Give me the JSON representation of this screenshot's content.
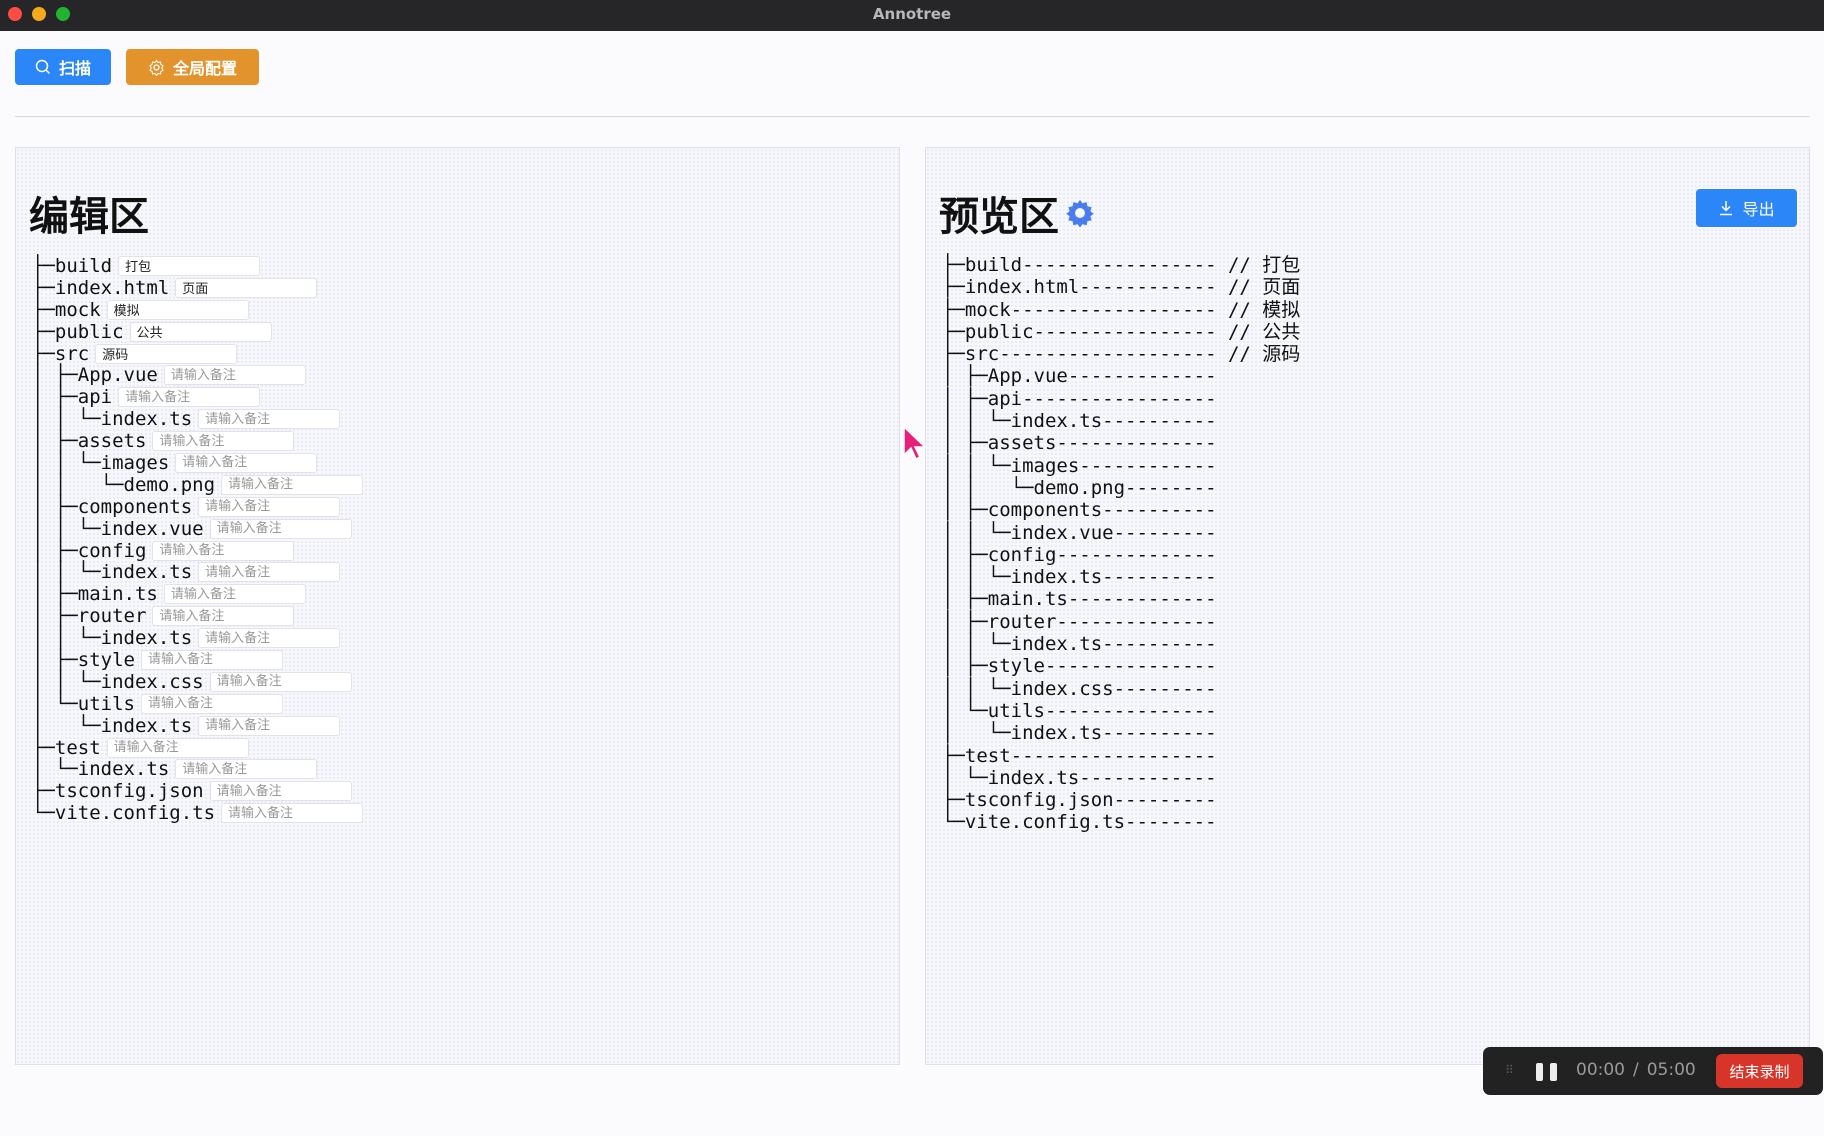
{
  "window": {
    "title": "Annotree"
  },
  "toolbar": {
    "scan_label": "扫描",
    "config_label": "全局配置"
  },
  "editor": {
    "title": "编辑区",
    "placeholder": "请输入备注",
    "rows": [
      {
        "prefix": "├─",
        "name": "build",
        "note": "打包"
      },
      {
        "prefix": "├─",
        "name": "index.html",
        "note": "页面"
      },
      {
        "prefix": "├─",
        "name": "mock",
        "note": "模拟"
      },
      {
        "prefix": "├─",
        "name": "public",
        "note": "公共"
      },
      {
        "prefix": "├─",
        "name": "src",
        "note": "源码"
      },
      {
        "prefix": "│ ├─",
        "name": "App.vue",
        "note": ""
      },
      {
        "prefix": "│ ├─",
        "name": "api",
        "note": ""
      },
      {
        "prefix": "│ │ └─",
        "name": "index.ts",
        "note": ""
      },
      {
        "prefix": "│ ├─",
        "name": "assets",
        "note": ""
      },
      {
        "prefix": "│ │ └─",
        "name": "images",
        "note": ""
      },
      {
        "prefix": "│ │   └─",
        "name": "demo.png",
        "note": ""
      },
      {
        "prefix": "│ ├─",
        "name": "components",
        "note": ""
      },
      {
        "prefix": "│ │ └─",
        "name": "index.vue",
        "note": ""
      },
      {
        "prefix": "│ ├─",
        "name": "config",
        "note": ""
      },
      {
        "prefix": "│ │ └─",
        "name": "index.ts",
        "note": ""
      },
      {
        "prefix": "│ ├─",
        "name": "main.ts",
        "note": ""
      },
      {
        "prefix": "│ ├─",
        "name": "router",
        "note": ""
      },
      {
        "prefix": "│ │ └─",
        "name": "index.ts",
        "note": ""
      },
      {
        "prefix": "│ ├─",
        "name": "style",
        "note": ""
      },
      {
        "prefix": "│ │ └─",
        "name": "index.css",
        "note": ""
      },
      {
        "prefix": "│ └─",
        "name": "utils",
        "note": ""
      },
      {
        "prefix": "│   └─",
        "name": "index.ts",
        "note": ""
      },
      {
        "prefix": "├─",
        "name": "test",
        "note": ""
      },
      {
        "prefix": "│ └─",
        "name": "index.ts",
        "note": ""
      },
      {
        "prefix": "├─",
        "name": "tsconfig.json",
        "note": ""
      },
      {
        "prefix": "└─",
        "name": "vite.config.ts",
        "note": ""
      }
    ]
  },
  "preview": {
    "title": "预览区",
    "export_label": "导出",
    "lines": [
      "├─build----------------- // 打包",
      "├─index.html------------ // 页面",
      "├─mock------------------ // 模拟",
      "├─public---------------- // 公共",
      "├─src------------------- // 源码",
      "│ ├─App.vue-------------",
      "│ ├─api-----------------",
      "│ │ └─index.ts----------",
      "│ ├─assets--------------",
      "│ │ └─images------------",
      "│ │   └─demo.png--------",
      "│ ├─components----------",
      "│ │ └─index.vue---------",
      "│ ├─config--------------",
      "│ │ └─index.ts----------",
      "│ ├─main.ts-------------",
      "│ ├─router--------------",
      "│ │ └─index.ts----------",
      "│ ├─style---------------",
      "│ │ └─index.css---------",
      "│ └─utils---------------",
      "│   └─index.ts----------",
      "├─test------------------",
      "│ └─index.ts------------",
      "├─tsconfig.json---------",
      "└─vite.config.ts--------"
    ]
  },
  "recorder": {
    "elapsed": "00:00",
    "separator": "/",
    "total": "05:00",
    "stop_label": "结束录制"
  },
  "colors": {
    "primary": "#2b86f7",
    "warning": "#e2932c",
    "danger": "#d8352a"
  }
}
